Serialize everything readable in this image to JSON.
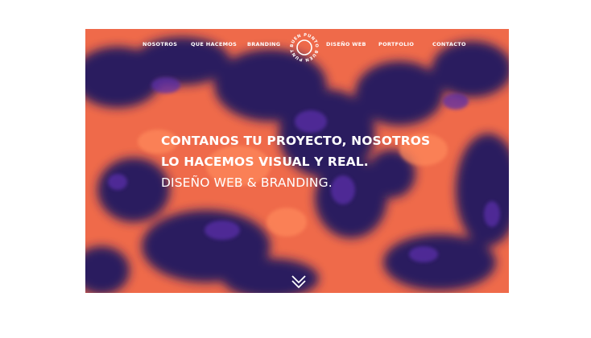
{
  "nav": {
    "items": [
      {
        "label": "NOSOTROS"
      },
      {
        "label": "QUE HACEMOS"
      },
      {
        "label": "BRANDING"
      },
      {
        "label": "DISEÑO WEB"
      },
      {
        "label": "PORTFOLIO"
      },
      {
        "label": "CONTACTO"
      }
    ],
    "logo_text": "BUEN PUNTO BUEN PUNTO"
  },
  "hero": {
    "line1": "CONTANOS TU PROYECTO, NOSOTROS",
    "line2": "LO HACEMOS VISUAL Y REAL.",
    "line3": "DISEÑO WEB & BRANDING."
  },
  "colors": {
    "accent": "#ef6a4a",
    "ink": "#2a1b5e",
    "text": "#ffffff"
  },
  "icons": {
    "scroll": "chevron-double-down-icon"
  }
}
